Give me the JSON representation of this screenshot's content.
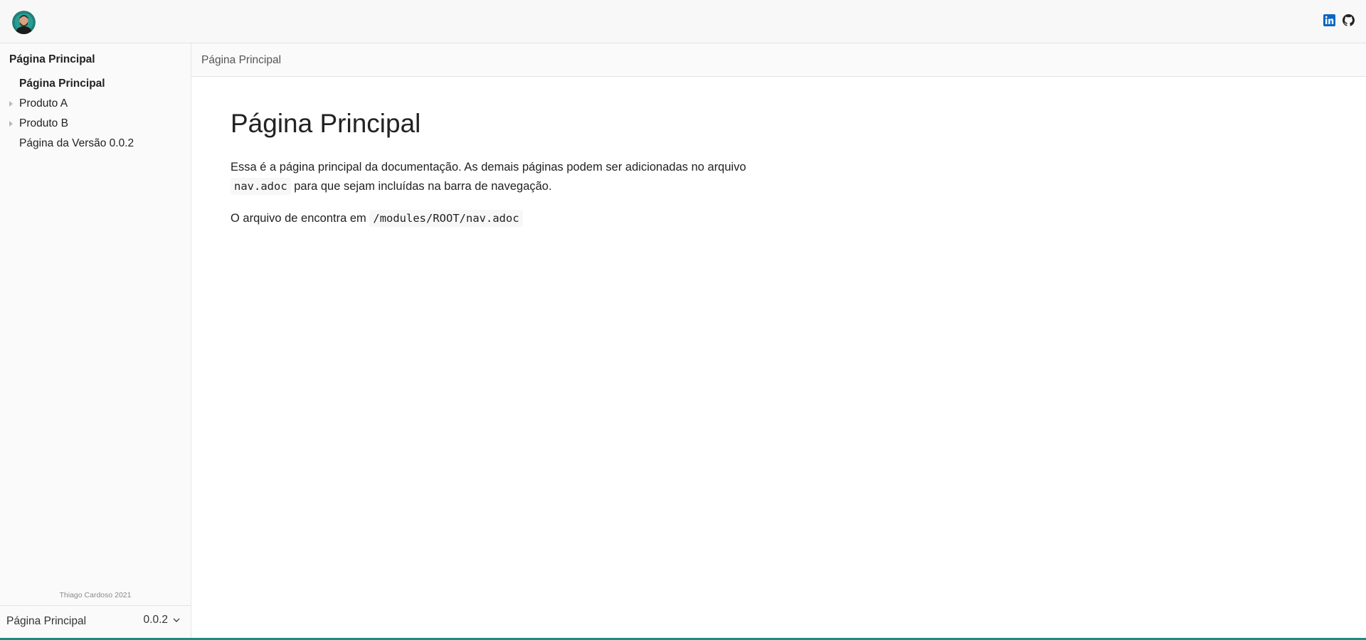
{
  "header": {
    "avatar_icon": "user-avatar-icon",
    "social_links": [
      {
        "name": "linkedin-icon",
        "color": "#0a66c2"
      },
      {
        "name": "github-icon",
        "color": "#222222"
      }
    ]
  },
  "sidebar": {
    "component_title": "Página Principal",
    "items": [
      {
        "label": "Página Principal",
        "current": true,
        "expandable": false
      },
      {
        "label": "Produto A",
        "current": false,
        "expandable": true
      },
      {
        "label": "Produto B",
        "current": false,
        "expandable": true
      },
      {
        "label": "Página da Versão 0.0.2",
        "current": false,
        "expandable": false
      }
    ],
    "footer_credit": "Thiago Cardoso 2021",
    "version_bar": {
      "title": "Página Principal",
      "version": "0.0.2",
      "icon": "chevron-down-icon"
    }
  },
  "toolbar": {
    "breadcrumb": "Página Principal"
  },
  "article": {
    "title": "Página Principal",
    "para1_before": "Essa é a página principal da documentação. As demais páginas podem ser adicionadas no arquivo ",
    "para1_code": "nav.adoc",
    "para1_after": " para que sejam incluídas na barra de navegação.",
    "para2_before": "O arquivo de encontra em ",
    "para2_code": "/modules/ROOT/nav.adoc"
  },
  "colors": {
    "accent": "#1b8c80",
    "sidebar_bg": "#fafafa",
    "border": "#e4e4e4"
  }
}
